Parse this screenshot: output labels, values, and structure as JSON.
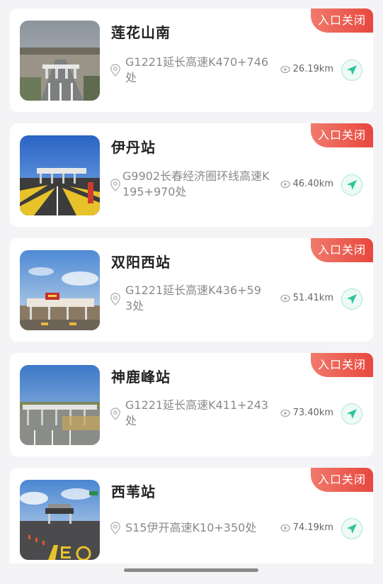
{
  "stations": [
    {
      "name": "莲花山南",
      "badge": "入口关闭",
      "address": "G1221延长高速K470+746处",
      "distance": "26.19km",
      "photo": "toll-plaza-aerial"
    },
    {
      "name": "伊丹站",
      "badge": "入口关闭",
      "address": "G9902长春经济圈环线高速K195+970处",
      "distance": "46.40km",
      "photo": "toll-plaza-blue-sky"
    },
    {
      "name": "双阳西站",
      "badge": "入口关闭",
      "address": "G1221延长高速K436+593处",
      "distance": "51.41km",
      "photo": "toll-plaza-red-sign"
    },
    {
      "name": "神鹿峰站",
      "badge": "入口关闭",
      "address": "G1221延长高速K411+243处",
      "distance": "73.40km",
      "photo": "toll-plaza-wide"
    },
    {
      "name": "西苇站",
      "badge": "入口关闭",
      "address": "S15伊开高速K10+350处",
      "distance": "74.19km",
      "photo": "toll-plaza-road-marking"
    }
  ],
  "colors": {
    "badge": "#e8473e",
    "nav_accent": "#2ec4a0"
  }
}
